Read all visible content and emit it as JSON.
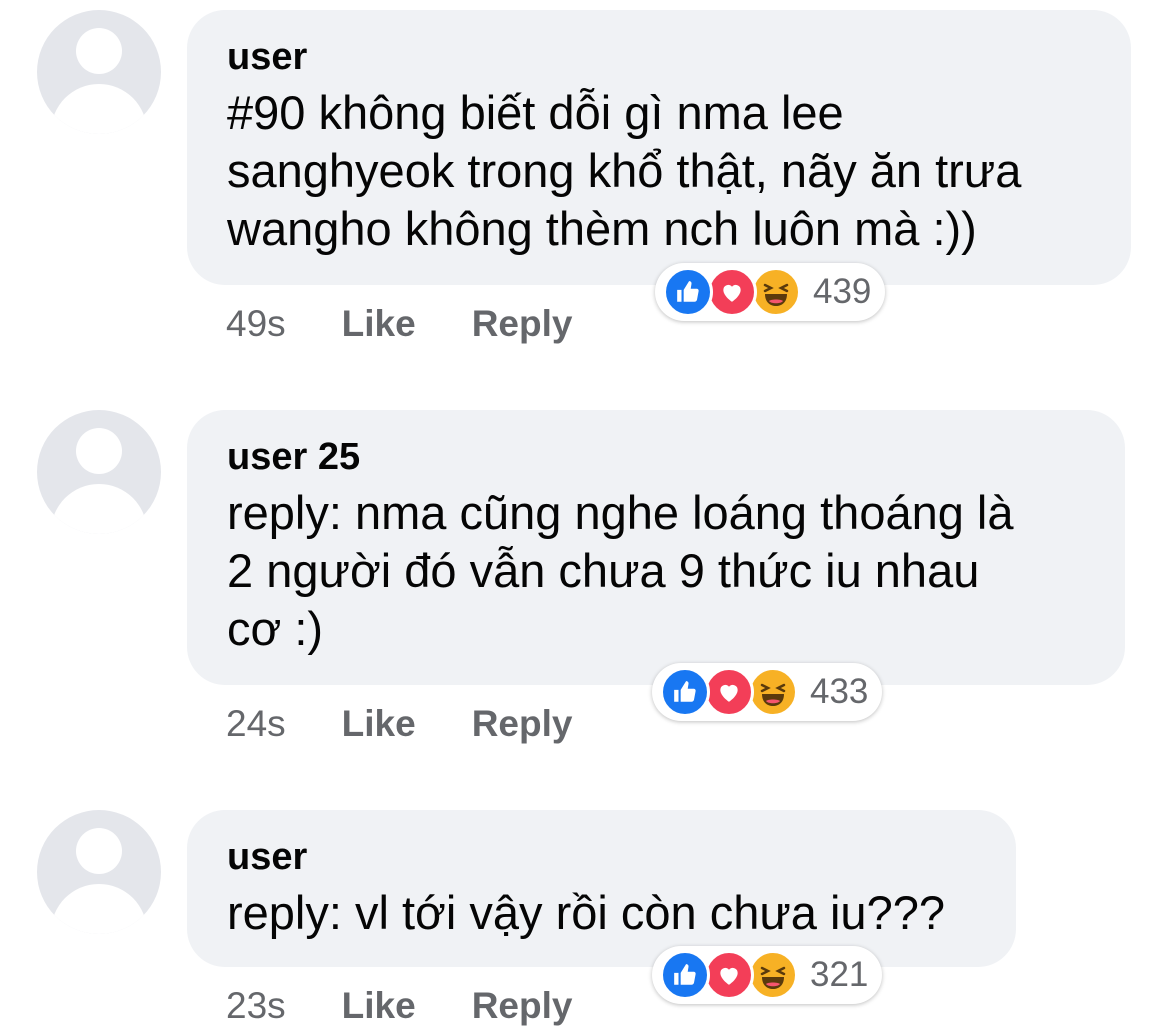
{
  "comments": [
    {
      "author": "user",
      "lines": [
        "#90 không biết dỗi gì nma lee",
        "sanghyeok trong khổ thật, nãy ăn trưa",
        "wangho không thèm nch luôn mà :))"
      ],
      "time": "49s",
      "like_label": "Like",
      "reply_label": "Reply",
      "reaction_count": "439",
      "reactions": [
        "like-icon",
        "love-icon",
        "haha-icon"
      ]
    },
    {
      "author": "user 25",
      "lines": [
        "reply: nma cũng nghe loáng thoáng là",
        "2 người đó vẫn chưa 9 thức iu nhau",
        "cơ :)"
      ],
      "time": "24s",
      "like_label": "Like",
      "reply_label": "Reply",
      "reaction_count": "433",
      "reactions": [
        "like-icon",
        "love-icon",
        "haha-icon"
      ]
    },
    {
      "author": "user",
      "lines": [
        "reply: vl tới vậy rồi còn chưa iu???"
      ],
      "time": "23s",
      "like_label": "Like",
      "reply_label": "Reply",
      "reaction_count": "321",
      "reactions": [
        "like-icon",
        "love-icon",
        "haha-icon"
      ]
    }
  ],
  "colors": {
    "bubble": "#f0f2f5",
    "secondary_text": "#65676b",
    "like_blue": "#1877f2",
    "love_red": "#f33e58",
    "haha_yellow": "#f7b125"
  }
}
